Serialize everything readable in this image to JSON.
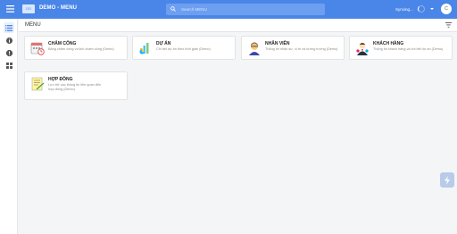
{
  "app": {
    "logo_text": "DS",
    "title": "DEMO - MENU"
  },
  "search": {
    "placeholder": "Search MENU"
  },
  "status": {
    "sync_text": "Syncing...",
    "avatar_initial": "C"
  },
  "page": {
    "title": "MENU"
  },
  "cards": [
    {
      "title": "CHẤM CÔNG",
      "desc": "Bảng chấm công và lịch chấm công (Demo)"
    },
    {
      "title": "DỰ ÁN",
      "desc": "Chi tiết dự án theo thời gian (Demo)"
    },
    {
      "title": "NHÂN VIÊN",
      "desc": "Thông tin nhân sự, vị trí và lương tương (Demo)"
    },
    {
      "title": "KHÁCH HÀNG",
      "desc": "Thông tin khách hàng và chi tiết dự án (Demo)"
    },
    {
      "title": "HỢP ĐỒNG",
      "desc": "Lưu trữ các thông tin liên quan đến hợp đồng (Demo)"
    }
  ],
  "colors": {
    "accent": "#4a86e8",
    "background": "#f4f5f7"
  },
  "icons": [
    "menu-icon",
    "search-icon",
    "filter-icon",
    "info-icon",
    "alert-icon",
    "grid-icon",
    "lightning-icon"
  ]
}
